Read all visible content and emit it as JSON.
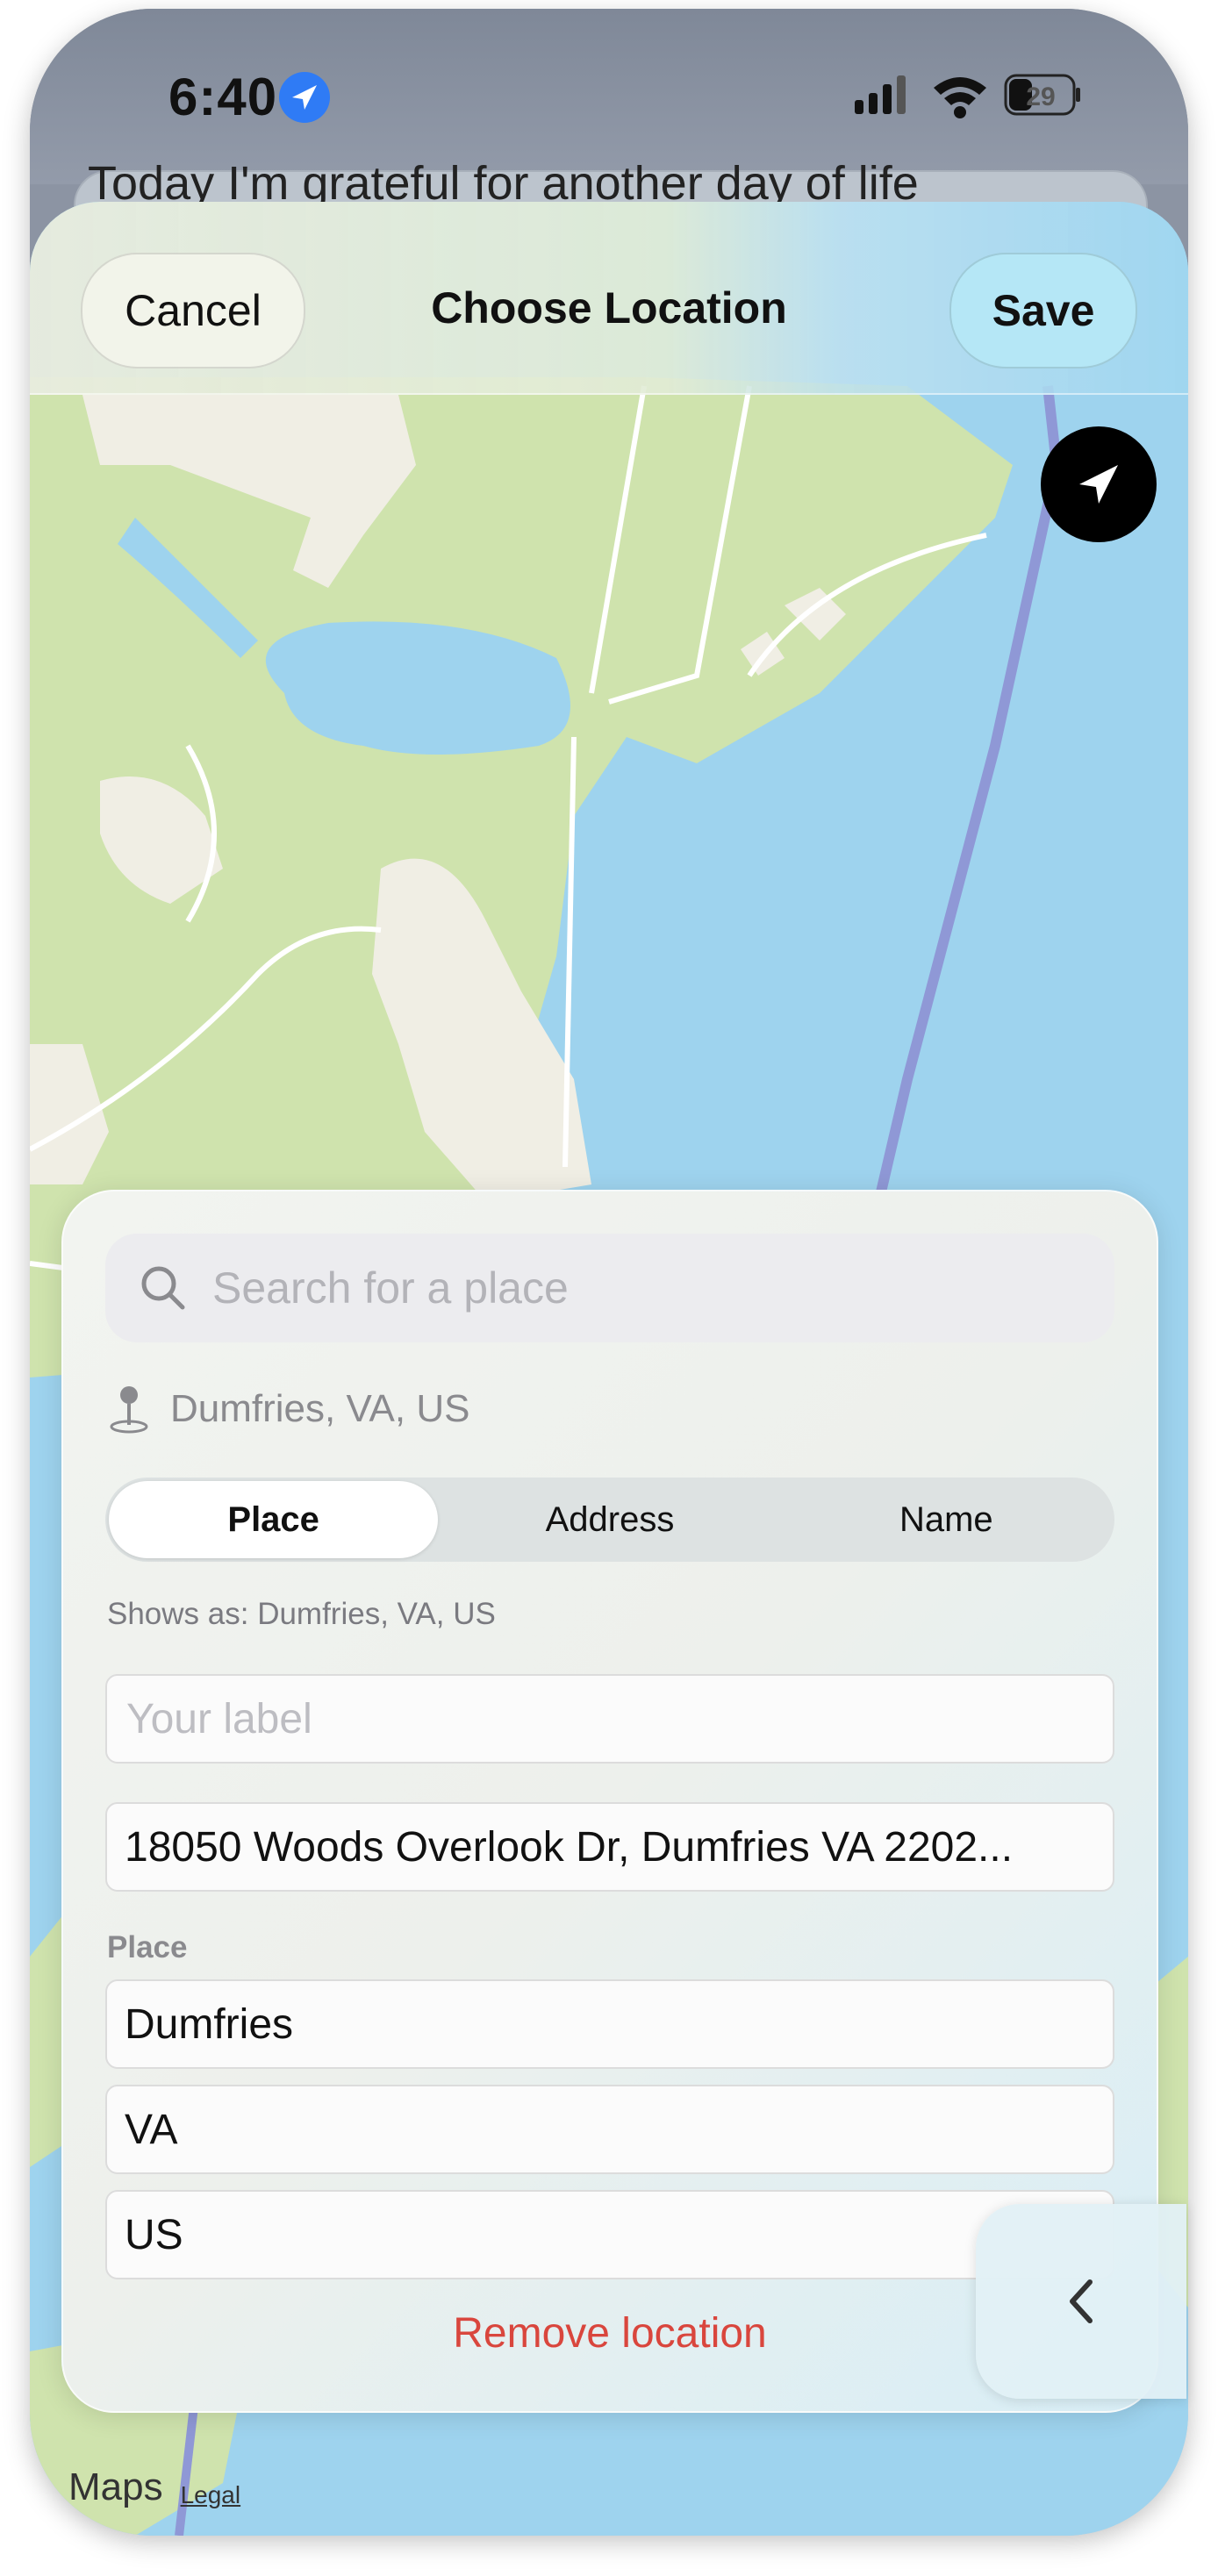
{
  "status_bar": {
    "time": "6:40",
    "battery": "29"
  },
  "background_card": {
    "text": "Today I'm grateful for another day of life"
  },
  "nav": {
    "cancel_label": "Cancel",
    "title": "Choose Location",
    "save_label": "Save"
  },
  "panel": {
    "search_placeholder": "Search for a place",
    "current_location": "Dumfries, VA, US",
    "segments": [
      {
        "label": "Place",
        "active": true
      },
      {
        "label": "Address",
        "active": false
      },
      {
        "label": "Name",
        "active": false
      }
    ],
    "shows_as": "Shows as: Dumfries, VA, US",
    "label_placeholder": "Your label",
    "address_value": "18050 Woods Overlook Dr, Dumfries VA 2202...",
    "place_section_label": "Place",
    "place_value": "Dumfries",
    "state_value": "VA",
    "country_value": "US",
    "remove_label": "Remove location"
  },
  "map": {
    "attribution": "Maps",
    "legal": "Legal",
    "water_color": "#9ed3ee",
    "land_color": "#cfe3ad",
    "urban_color": "#f0eee4"
  },
  "icons": {
    "location_arrow": "location-arrow-icon",
    "search": "search-icon",
    "pin": "pin-icon",
    "chevron": "chevron-left-icon"
  }
}
